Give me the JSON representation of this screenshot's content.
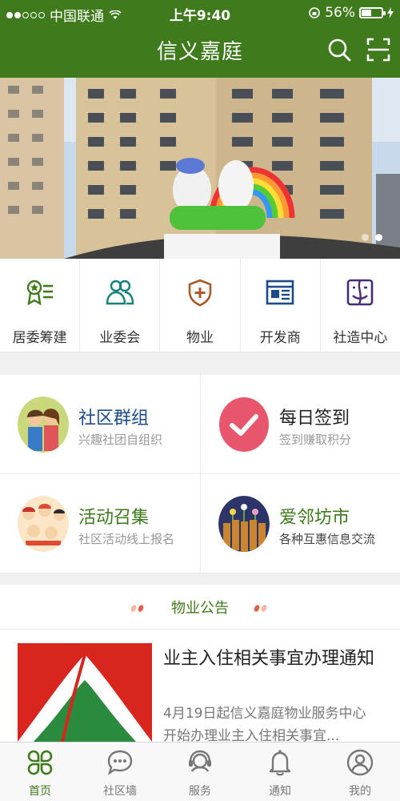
{
  "status_bar": {
    "carrier": "中国联通",
    "time": "上午9:40",
    "battery": "56%",
    "battery_level": 0.56
  },
  "header": {
    "title": "信义嘉庭",
    "search_icon": "search-icon",
    "scan_icon": "scan-icon"
  },
  "banner": {
    "slides": 2,
    "active_slide": 2
  },
  "categories": [
    {
      "label": "居委筹建",
      "icon": "award-list-icon"
    },
    {
      "label": "业委会",
      "icon": "people-icon"
    },
    {
      "label": "物业",
      "icon": "shield-plus-icon"
    },
    {
      "label": "开发商",
      "icon": "newspaper-icon"
    },
    {
      "label": "社造中心",
      "icon": "face-window-icon"
    }
  ],
  "features": [
    {
      "title": "社区群组",
      "subtitle": "兴趣社团自组织",
      "title_color": "#1c4a8a"
    },
    {
      "title": "每日签到",
      "subtitle": "签到赚取积分",
      "title_color": "#222222"
    },
    {
      "title": "活动召集",
      "subtitle": "社区活动线上报名",
      "title_color": "#3f7a1d"
    },
    {
      "title": "爱邻坊市",
      "subtitle": "各种互惠信息交流",
      "title_color": "#3f7a1d"
    }
  ],
  "notice": {
    "section_title": "物业公告",
    "items": [
      {
        "title": "业主入住相关事宜办理通知",
        "summary": "4月19日起信义嘉庭物业服务中心开始办理业主入住相关事宜..."
      }
    ]
  },
  "tabbar": [
    {
      "label": "首页",
      "icon": "home-clover-icon",
      "active": true
    },
    {
      "label": "社区墙",
      "icon": "chat-bubble-icon",
      "active": false
    },
    {
      "label": "服务",
      "icon": "headset-icon",
      "active": false
    },
    {
      "label": "通知",
      "icon": "bell-icon",
      "active": false
    },
    {
      "label": "我的",
      "icon": "user-icon",
      "active": false
    }
  ],
  "colors": {
    "brand_green": "#3f7a1d",
    "checkin_red": "#e8566b"
  }
}
